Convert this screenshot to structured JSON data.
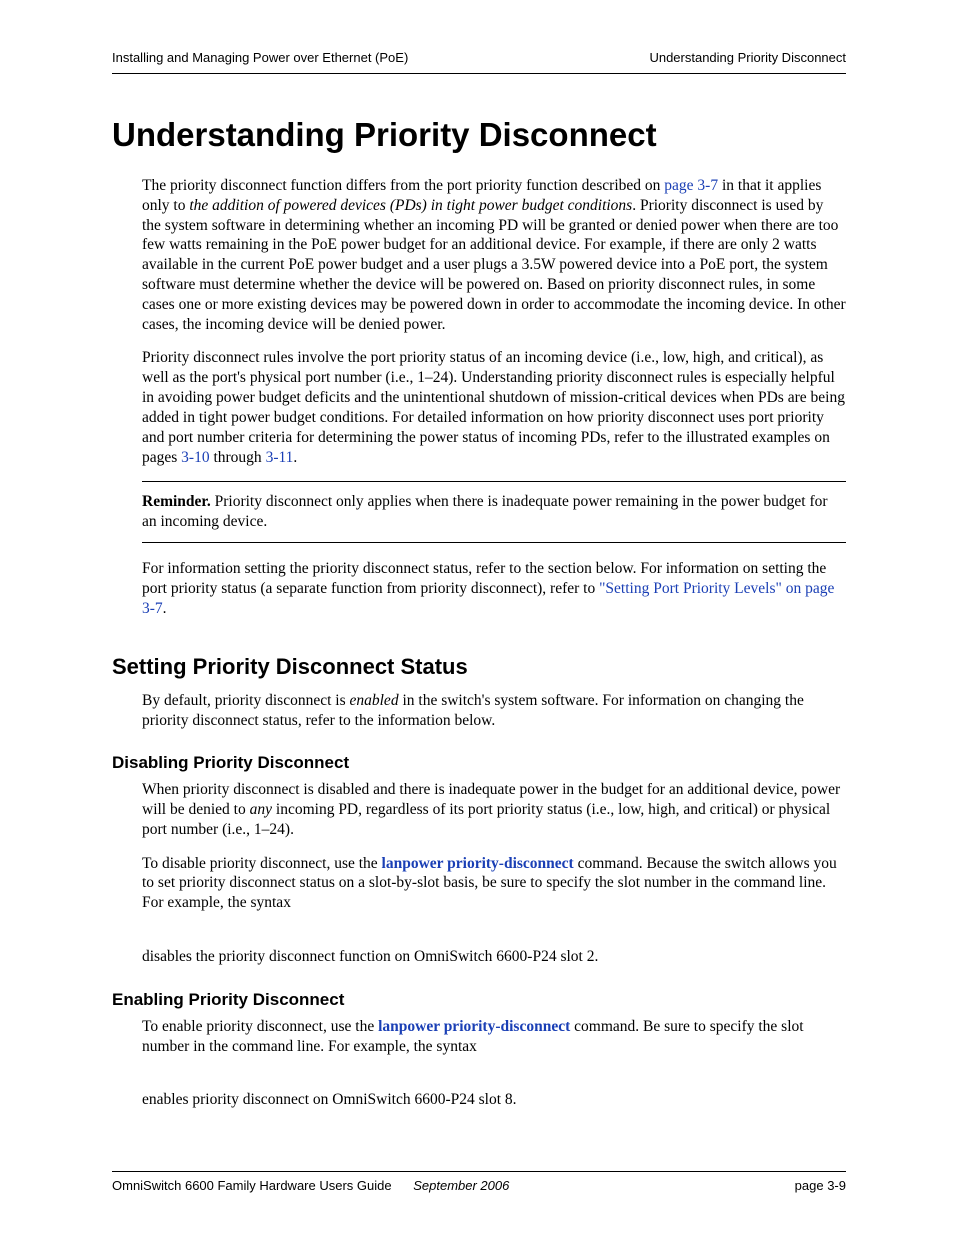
{
  "header": {
    "left": "Installing and Managing Power over Ethernet (PoE)",
    "right": "Understanding Priority Disconnect"
  },
  "title": "Understanding Priority Disconnect",
  "p1a": "The priority disconnect function differs from the port priority function described on ",
  "p1link1": "page 3-7",
  "p1b": " in that it applies only to ",
  "p1italic": "the addition of powered devices (PDs) in tight power budget conditions",
  "p1c": ". Priority disconnect is used by the system software in determining whether an incoming PD will be granted or denied power when there are too few watts remaining in the PoE power budget for an additional device. For example, if there are only 2 watts available in the current PoE power budget and a user plugs a 3.5W powered device into a PoE port, the system software must determine whether the device will be powered on. Based on priority disconnect rules, in some cases one or more existing devices may be powered down in order to accommodate the incoming device. In other cases, the incoming device will be denied power.",
  "p2a": "Priority disconnect rules involve the port priority status of an incoming device (i.e., low, high, and critical), as well as the port's physical port number (i.e., 1–24). Understanding priority disconnect rules is especially helpful in avoiding power budget deficits and the unintentional shutdown of mission-critical devices when PDs are being added in tight power budget conditions. For detailed information on how priority disconnect uses port priority and port number criteria for determining the power status of incoming PDs, refer to the illustrated examples on pages ",
  "p2link1": "3-10",
  "p2b": " through ",
  "p2link2": "3-11",
  "p2c": ".",
  "callout_label": "Reminder.",
  "callout_text": " Priority disconnect only applies when there is inadequate power remaining in the power budget for an incoming device.",
  "p3a": "For information setting the priority disconnect status, refer to the section below. For information on setting the port priority status (a separate function from priority disconnect), refer to ",
  "p3link": "\"Setting Port Priority Levels\" on page 3-7",
  "p3b": ".",
  "h2_1": "Setting Priority Disconnect Status",
  "p4a": "By default, priority disconnect is ",
  "p4italic": "enabled",
  "p4b": " in the switch's system software. For information on changing the priority disconnect status, refer to the information below.",
  "h3_1": "Disabling Priority Disconnect",
  "p5a": "When priority disconnect is disabled and there is inadequate power in the budget for an additional device, power will be denied to ",
  "p5italic": "any",
  "p5b": " incoming PD, regardless of its port priority status (i.e., low, high, and critical) or physical port number (i.e., 1–24).",
  "p6a": "To disable priority disconnect, use the ",
  "p6link": "lanpower priority-disconnect",
  "p6b": " command. Because the switch allows you to set priority disconnect status on a slot-by-slot basis, be sure to specify the slot number in the command line. For example, the syntax",
  "p7": "disables the priority disconnect function on OmniSwitch 6600-P24 slot 2.",
  "h3_2": "Enabling Priority Disconnect",
  "p8a": "To enable priority disconnect, use the ",
  "p8link": "lanpower priority-disconnect",
  "p8b": " command. Be sure to specify the slot number in the command line. For example, the syntax",
  "p9": "enables priority disconnect on OmniSwitch 6600-P24 slot 8.",
  "footer": {
    "guide": "OmniSwitch 6600 Family Hardware Users Guide",
    "date": "September 2006",
    "page": "page 3-9"
  }
}
